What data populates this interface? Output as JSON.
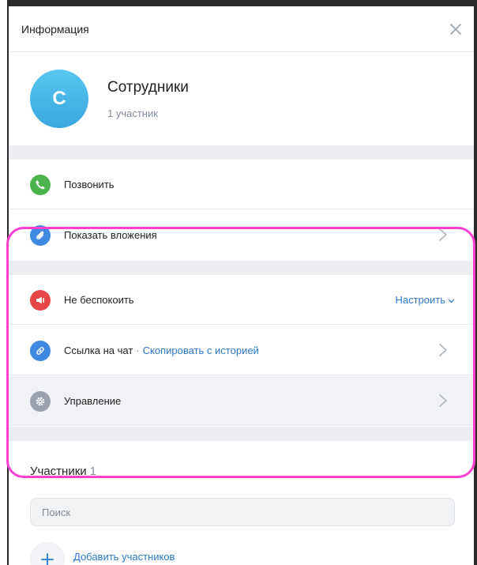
{
  "header": {
    "title": "Информация"
  },
  "group": {
    "avatar_letter": "С",
    "name": "Сотрудники",
    "subtitle": "1 участник"
  },
  "rows": {
    "call": {
      "label": "Позвонить"
    },
    "attachments": {
      "label": "Показать вложения"
    },
    "dnd": {
      "label": "Не беспокоить",
      "action": "Настроить"
    },
    "link": {
      "label": "Ссылка на чат",
      "separator": "·",
      "action": "Скопировать с историей"
    },
    "manage": {
      "label": "Управление"
    }
  },
  "members": {
    "title": "Участники",
    "count": "1",
    "search_placeholder": "Поиск",
    "add_label": "Добавить участников"
  },
  "colors": {
    "call_green": "#4bb34b",
    "attach_blue": "#3f8ae0",
    "dnd_red": "#e64646",
    "link_blue": "#3f8ae0",
    "manage_gray": "#99a2ad",
    "accent_link": "#2a78cc",
    "highlight": "#ff3fd0"
  },
  "icons": [
    "close-icon",
    "phone-icon",
    "paperclip-icon",
    "megaphone-mute-icon",
    "link-icon",
    "gear-icon",
    "chevron-right-icon",
    "chevron-down-icon",
    "plus-icon"
  ]
}
